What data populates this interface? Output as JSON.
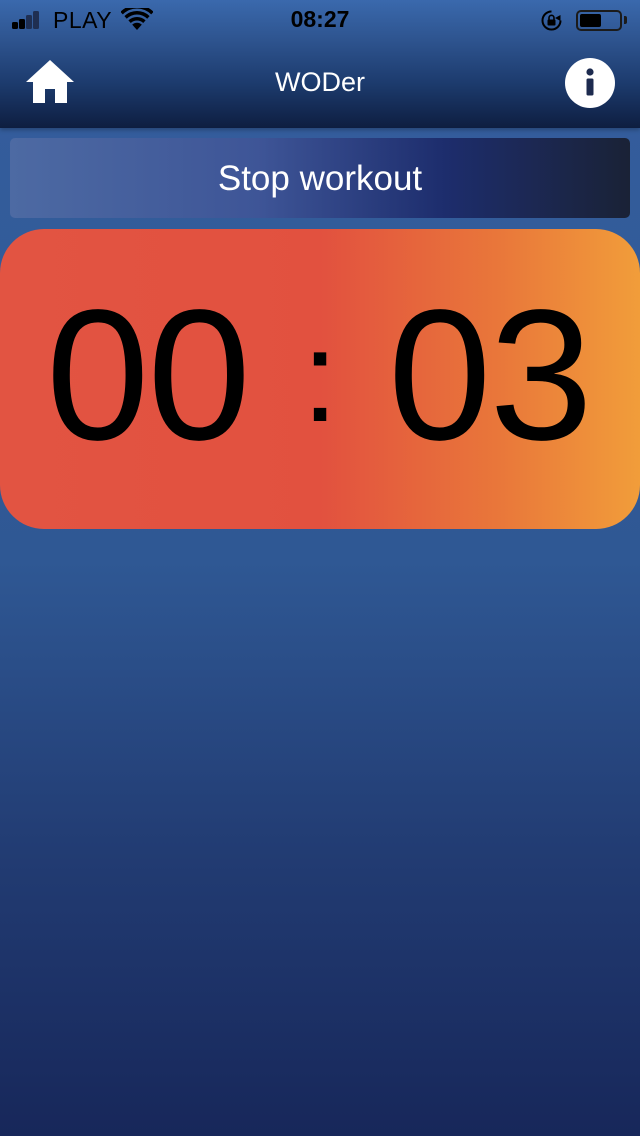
{
  "status_bar": {
    "carrier": "PLAY",
    "time": "08:27",
    "signal_icon": "signal-icon",
    "wifi_icon": "wifi-icon",
    "rotation_lock_icon": "rotation-lock-icon",
    "battery_icon": "battery-icon",
    "battery_level": 0.55
  },
  "nav": {
    "title": "WODer",
    "home_icon": "home-icon",
    "info_icon": "info-icon"
  },
  "workout": {
    "stop_label": "Stop workout"
  },
  "timer": {
    "minutes": "00",
    "separator": ":",
    "seconds": "03"
  },
  "colors": {
    "background_top": "#355e9e",
    "background_bottom": "#17275a",
    "timer_red": "#e2513f",
    "timer_orange": "#f19d3a"
  }
}
